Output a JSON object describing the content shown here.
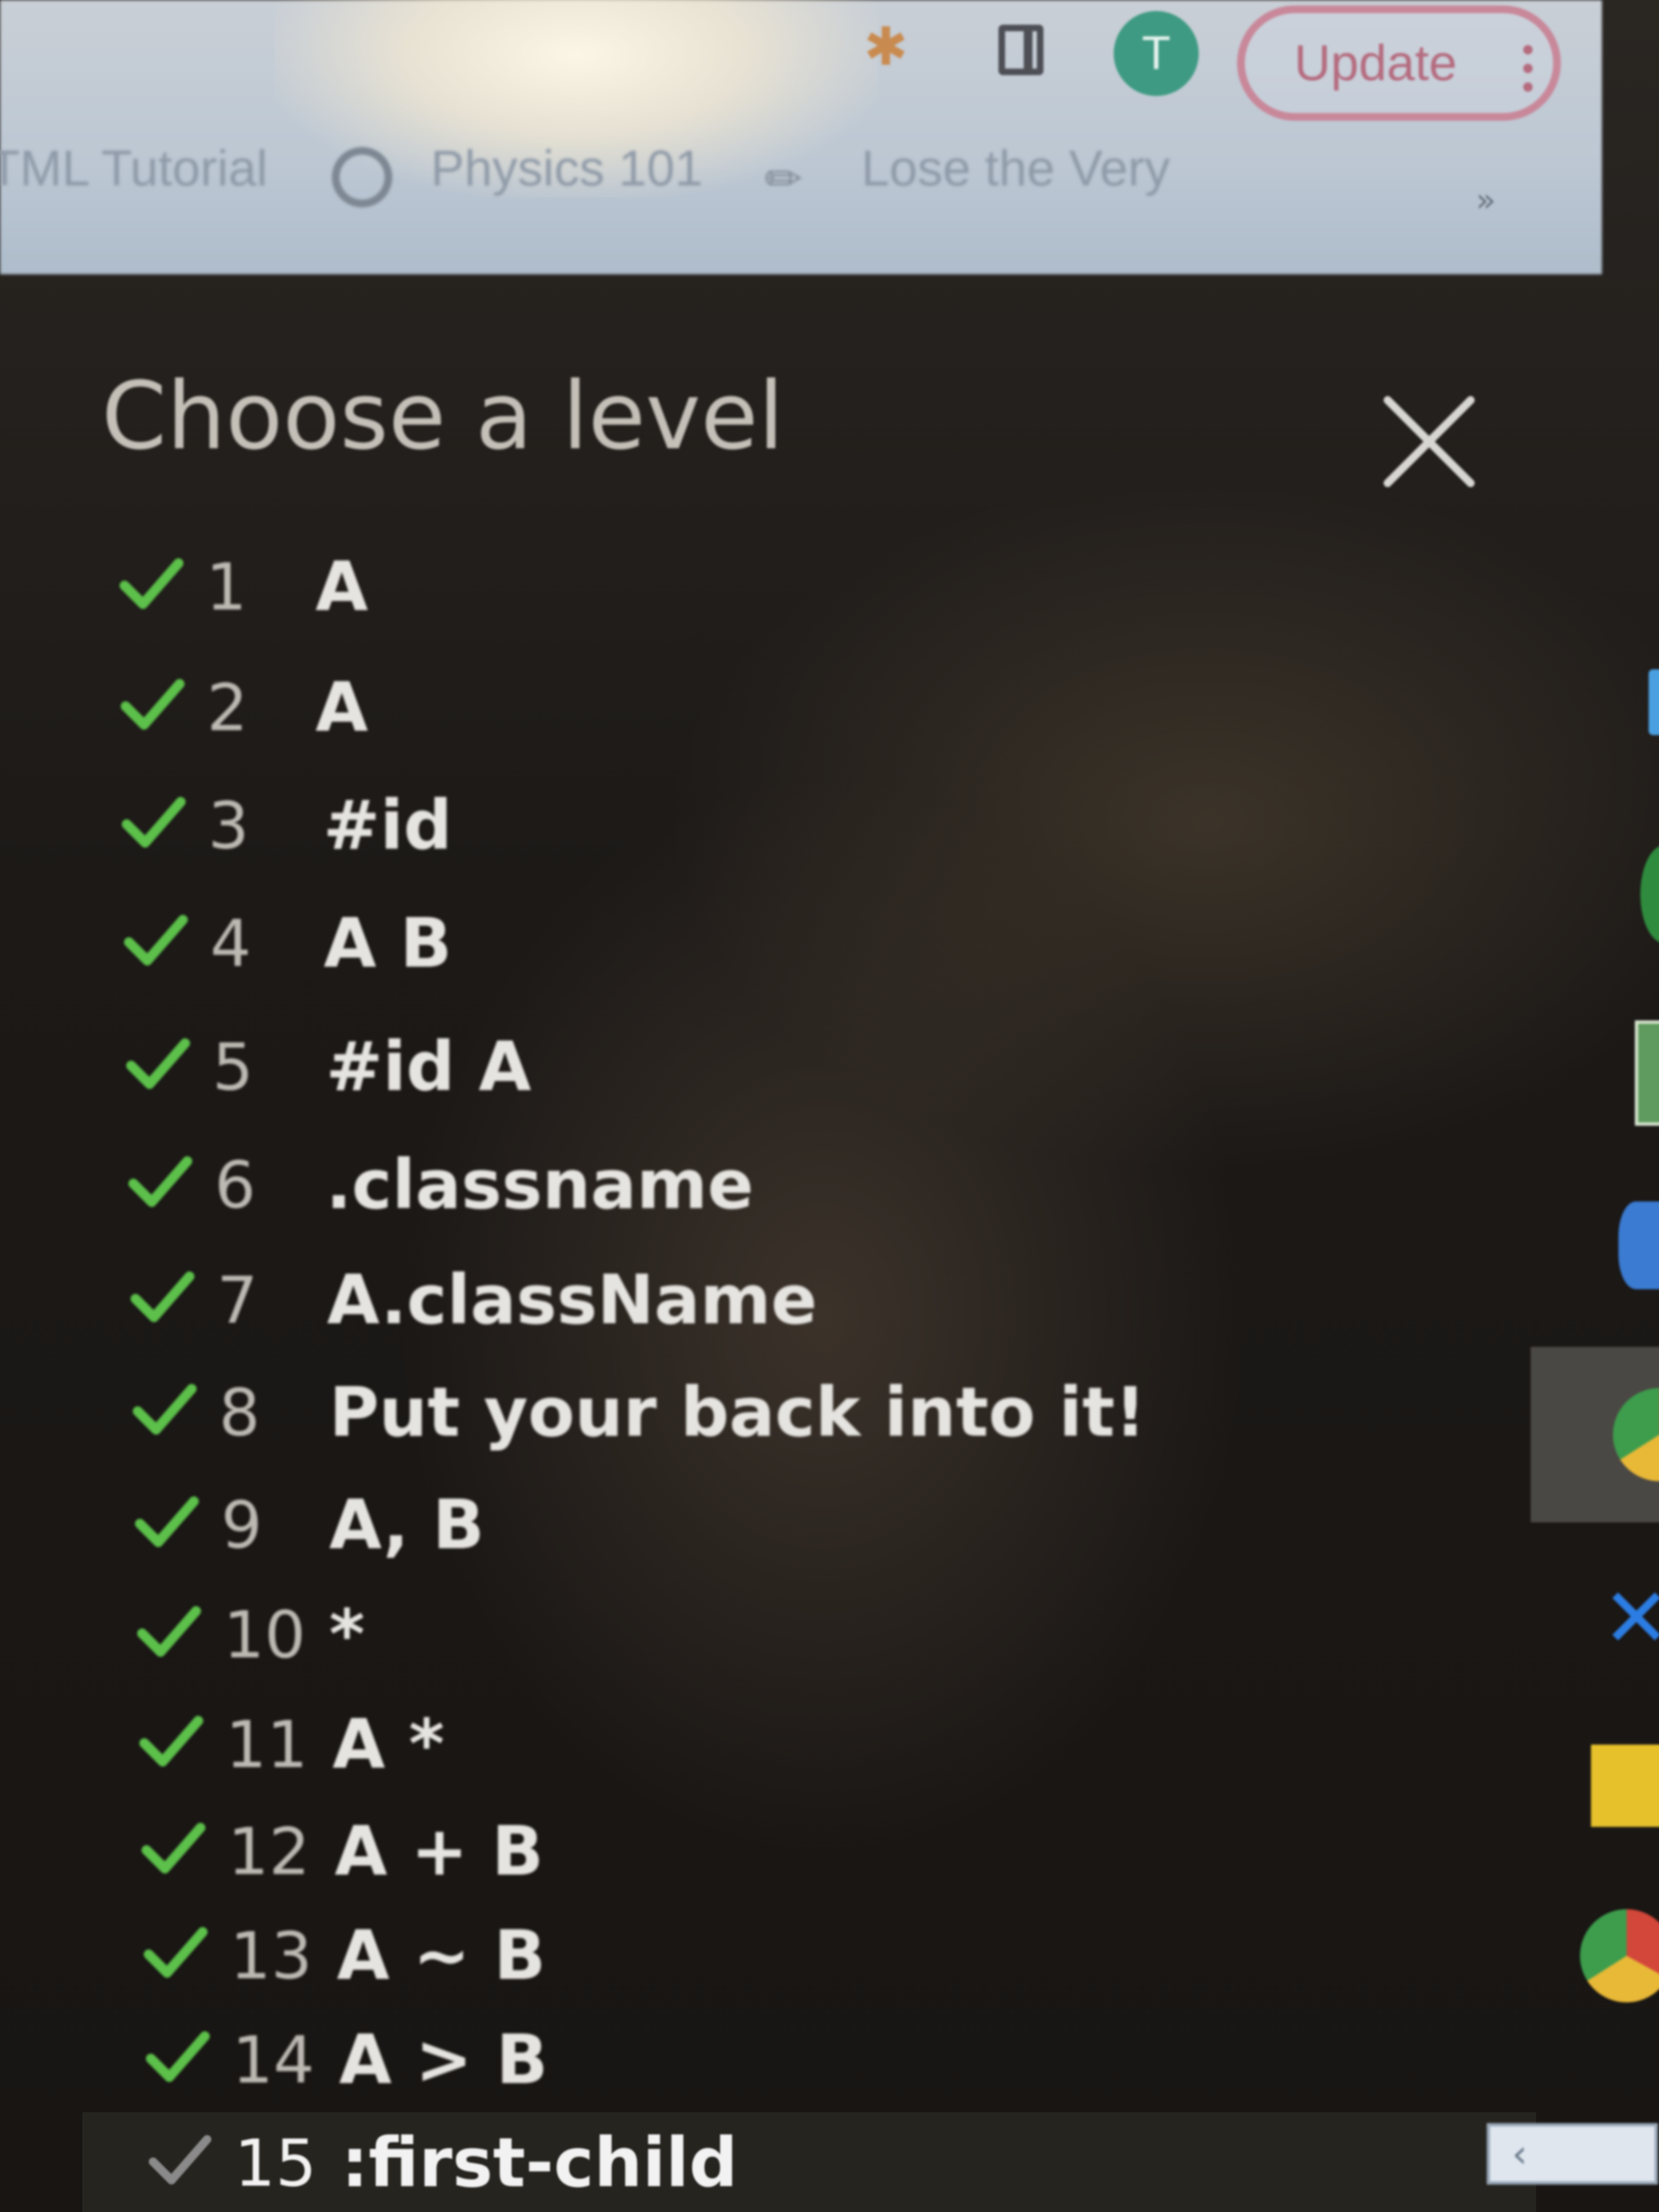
{
  "browser": {
    "avatar_letter": "T",
    "update_label": "Update",
    "menu_icon": "kebab-menu-icon",
    "bookmarks": [
      {
        "label": "TML Tutorial",
        "icon": null
      },
      {
        "label": "Physics 101",
        "icon": "globe-icon"
      },
      {
        "label": "Lose the Very",
        "icon": "pencil-icon"
      }
    ],
    "bookmarks_more": "»"
  },
  "dialog": {
    "title": "Choose a level",
    "close_icon": "close-icon"
  },
  "levels": [
    {
      "number": "1",
      "selector": "A",
      "completed": true
    },
    {
      "number": "2",
      "selector": "A",
      "completed": true
    },
    {
      "number": "3",
      "selector": "#id",
      "completed": true
    },
    {
      "number": "4",
      "selector": "A B",
      "completed": true
    },
    {
      "number": "5",
      "selector": "#id A",
      "completed": true
    },
    {
      "number": "6",
      "selector": ".classname",
      "completed": true
    },
    {
      "number": "7",
      "selector": "A.className",
      "completed": true
    },
    {
      "number": "8",
      "selector": "Put your back into it!",
      "completed": true
    },
    {
      "number": "9",
      "selector": "A, B",
      "completed": true
    },
    {
      "number": "10",
      "selector": "*",
      "completed": true
    },
    {
      "number": "11",
      "selector": "A *",
      "completed": true
    },
    {
      "number": "12",
      "selector": "A + B",
      "completed": true
    },
    {
      "number": "13",
      "selector": "A ~ B",
      "completed": true
    },
    {
      "number": "14",
      "selector": "A > B",
      "completed": true
    },
    {
      "number": "15",
      "selector": ":first-child",
      "completed": false,
      "current": true
    }
  ],
  "colors": {
    "check_done": "#5cc04a",
    "check_pending": "#8a8a8a",
    "title": "#c4c0b8",
    "selector": "#e6e4e0"
  }
}
